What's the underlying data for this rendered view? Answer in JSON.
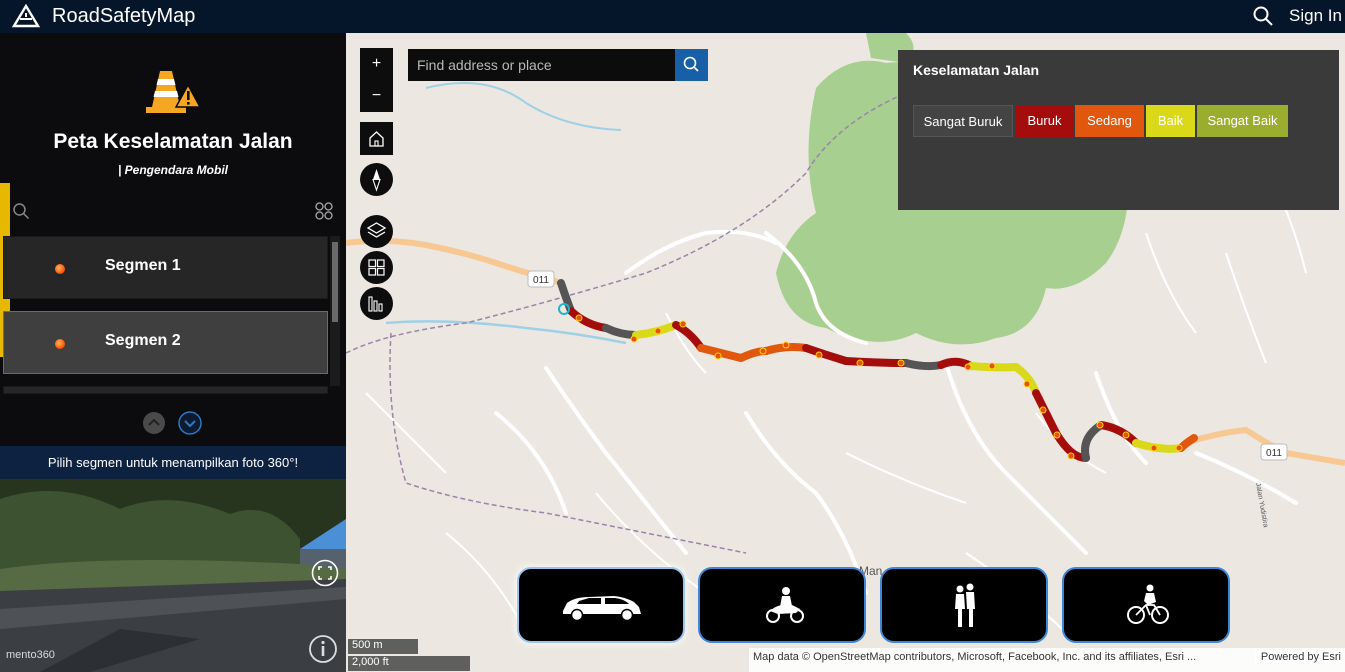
{
  "app": {
    "title": "RoadSafetyMap",
    "sign_in": "Sign In"
  },
  "panel": {
    "heading": "Peta Keselamatan Jalan",
    "subheading": "| Pengendara Mobil",
    "segments": [
      {
        "label": "Segmen 1"
      },
      {
        "label": "Segmen 2"
      }
    ],
    "photo_prompt": "Pilih segmen untuk menampilkan foto 360°!",
    "photo_watermark": "mento360"
  },
  "map": {
    "search_placeholder": "Find address or place",
    "zoom_in": "+",
    "zoom_out": "−",
    "road_label_1": "011",
    "road_label_2": "011",
    "place_label": "Man",
    "street_label": "Jalan Yudistira",
    "scale_metric": "500 m",
    "scale_imperial": "2,000 ft",
    "attribution": "Map data © OpenStreetMap contributors, Microsoft, Facebook, Inc. and its affiliates, Esri ...",
    "powered_by": "Powered by Esri"
  },
  "legend": {
    "title": "Keselamatan Jalan",
    "items": [
      {
        "label": "Sangat Buruk",
        "color": "#444444"
      },
      {
        "label": "Buruk",
        "color": "#a50d0d"
      },
      {
        "label": "Sedang",
        "color": "#e0570d"
      },
      {
        "label": "Baik",
        "color": "#d9d91a"
      },
      {
        "label": "Sangat Baik",
        "color": "#9aad2e"
      }
    ]
  },
  "modes": [
    {
      "name": "car-icon",
      "active": true
    },
    {
      "name": "motorcycle-icon",
      "active": false
    },
    {
      "name": "pedestrian-icon",
      "active": false
    },
    {
      "name": "bicycle-icon",
      "active": false
    }
  ]
}
